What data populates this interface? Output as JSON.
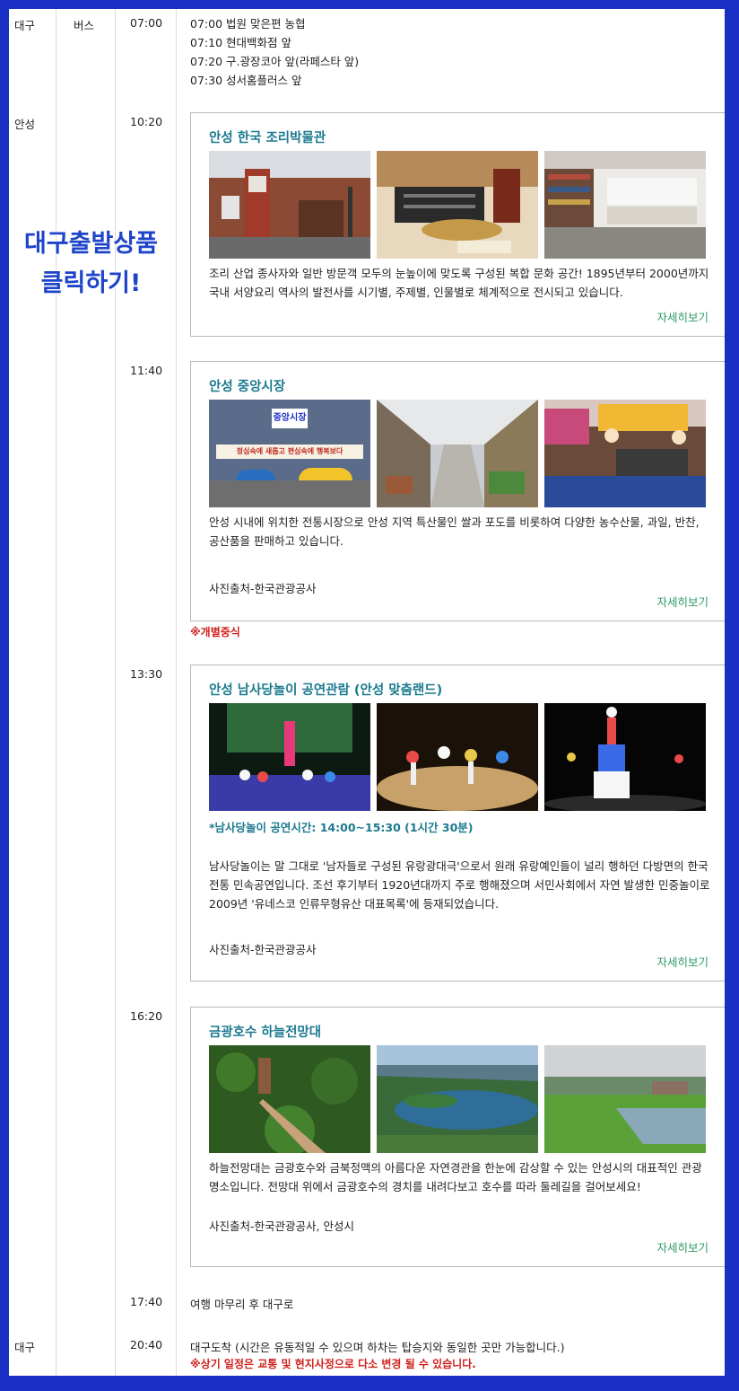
{
  "schedule": {
    "row_daegu_start": {
      "region": "대구",
      "transport": "버스",
      "time": "07:00",
      "stops": [
        "07:00 법원 맞은편 농협",
        "07:10 현대백화점 앞",
        "07:20 구.광장코아 앞(라페스타 앞)",
        "07:30 성서홈플러스 앞"
      ]
    },
    "region_anseong": "안성",
    "promo": {
      "line1": "대구출발상품",
      "line2": "클릭하기!"
    },
    "stop1": {
      "time": "10:20",
      "title": "안성 한국 조리박물관",
      "desc": "조리 산업 종사자와 일반 방문객 모두의 눈높이에 맞도록 구성된 복합 문화 공간! 1895년부터 2000년까지 국내 서양요리 역사의 발전사를 시기별, 주제별, 인물별로 체계적으로 전시되고 있습니다.",
      "more": "자세히보기"
    },
    "stop2": {
      "time": "11:40",
      "title": "안성 중앙시장",
      "desc": "안성 시내에 위치한 전통시장으로 안성 지역 특산물인 쌀과 포도를 비롯하여 다양한 농수산물, 과일, 반찬, 공산품을 판매하고 있습니다.",
      "credit": "사진출처-한국관광공사",
      "more": "자세히보기",
      "sign1": "중앙시장",
      "sign2": "정심속에 새롭고 편심속에 행복보다",
      "meal_note": "※개별중식"
    },
    "stop3": {
      "time": "13:30",
      "title": "안성 남사당놀이 공연관람 (안성 맞춤랜드)",
      "perf_time": "*남사당놀이 공연시간: 14:00~15:30 (1시간 30분)",
      "desc": "남사당놀이는 말 그대로 '남자들로 구성된 유랑광대극'으로서 원래 유랑예인들이 널리 행하던 다방면의 한국 전통 민속공연입니다. 조선 후기부터 1920년대까지 주로 행해졌으며 서민사회에서 자연 발생한 민중놀이로 2009년 '유네스코 인류무형유산 대표목록'에 등재되었습니다.",
      "credit": "사진출처-한국관광공사",
      "more": "자세히보기"
    },
    "stop4": {
      "time": "16:20",
      "title": "금광호수 하늘전망대",
      "desc": "하늘전망대는 금광호수와 금북정맥의 아름다운 자연경관을 한눈에 감상할 수 있는 안성시의 대표적인 관광 명소입니다. 전망대 위에서 금광호수의 경치를 내려다보고 호수를 따라 둘레길을 걸어보세요!",
      "credit": "사진출처-한국관광공사, 안성시",
      "more": "자세히보기"
    },
    "row_return": {
      "time": "17:40",
      "text": "여행 마무리 후 대구로"
    },
    "row_arrival": {
      "region": "대구",
      "time": "20:40",
      "text": "대구도착 (시간은 유동적일 수 있으며 하차는 탑승지와 동일한 곳만 가능합니다.)",
      "note": "※상기 일정은 교통 및 현지사정으로 다소 변경 될 수 있습니다."
    }
  },
  "colors": {
    "border_blue": "#1a2fc4",
    "title_teal": "#1b7a8f",
    "link_green": "#2e9a66",
    "note_red": "#d0211e",
    "promo_blue": "#1e44c9"
  }
}
